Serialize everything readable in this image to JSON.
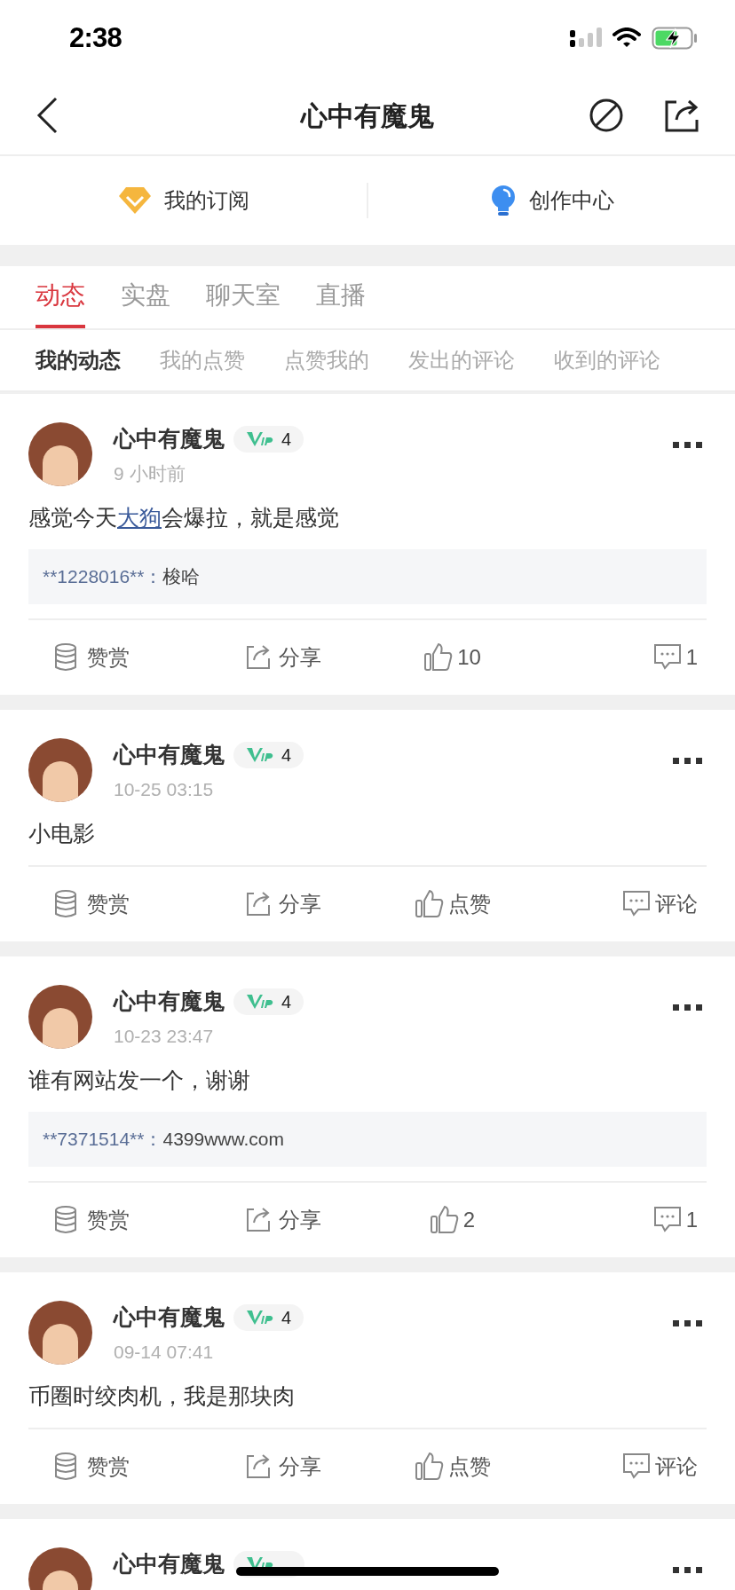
{
  "status_bar": {
    "time": "2:38"
  },
  "nav": {
    "title": "心中有魔鬼"
  },
  "quick_links": [
    {
      "kind": "subscription",
      "label": "我的订阅"
    },
    {
      "kind": "creation",
      "label": "创作中心"
    }
  ],
  "tabs": [
    {
      "label": "动态",
      "selected": true
    },
    {
      "label": "实盘",
      "selected": false
    },
    {
      "label": "聊天室",
      "selected": false
    },
    {
      "label": "直播",
      "selected": false
    }
  ],
  "subtabs": [
    {
      "label": "我的动态",
      "selected": true
    },
    {
      "label": "我的点赞",
      "selected": false
    },
    {
      "label": "点赞我的",
      "selected": false
    },
    {
      "label": "发出的评论",
      "selected": false
    },
    {
      "label": "收到的评论",
      "selected": false
    }
  ],
  "posts": [
    {
      "author": "心中有魔鬼",
      "vip_level": "4",
      "time": "9 小时前",
      "content": [
        {
          "kind": "text",
          "text": "感觉今天"
        },
        {
          "kind": "link",
          "text": "大狗"
        },
        {
          "kind": "text",
          "text": "会爆拉，就是感觉"
        }
      ],
      "comment": {
        "user": "**1228016**：",
        "text": "梭哈"
      },
      "actions": {
        "reward": "赞赏",
        "share": "分享",
        "like": "10",
        "reply": "1"
      }
    },
    {
      "author": "心中有魔鬼",
      "vip_level": "4",
      "time": "10-25 03:15",
      "content": [
        {
          "kind": "text",
          "text": "小电影"
        }
      ],
      "actions": {
        "reward": "赞赏",
        "share": "分享",
        "like": "点赞",
        "reply": "评论"
      }
    },
    {
      "author": "心中有魔鬼",
      "vip_level": "4",
      "time": "10-23 23:47",
      "content": [
        {
          "kind": "text",
          "text": "谁有网站发一个，谢谢"
        }
      ],
      "comment": {
        "user": "**7371514**：",
        "text": "4399www.com"
      },
      "actions": {
        "reward": "赞赏",
        "share": "分享",
        "like": "2",
        "reply": "1"
      }
    },
    {
      "author": "心中有魔鬼",
      "vip_level": "4",
      "time": "09-14 07:41",
      "content": [
        {
          "kind": "text",
          "text": "币圈时绞肉机，我是那块肉"
        }
      ],
      "actions": {
        "reward": "赞赏",
        "share": "分享",
        "like": "点赞",
        "reply": "评论"
      }
    },
    {
      "author": "心中有魔鬼"
    }
  ]
}
